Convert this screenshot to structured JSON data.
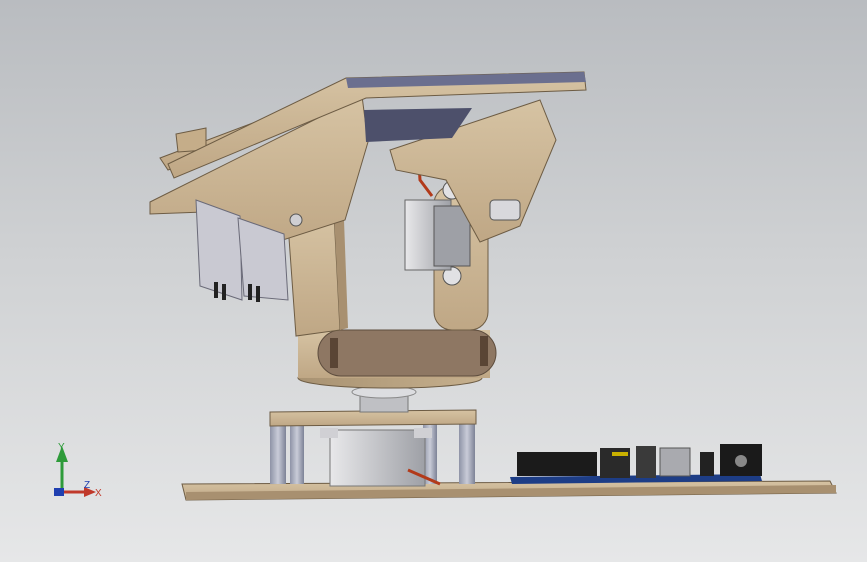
{
  "viewport": {
    "background_top": "#b9bcc0",
    "background_bottom": "#e6e7e8",
    "wood_color": "#cbb594",
    "wood_dark": "#a38d6d",
    "panel_color": "#6b6f8f"
  },
  "triad": {
    "y_label": "Y",
    "x_label": "X",
    "z_label": "Z",
    "y_color": "#2e9b3a",
    "x_color": "#c0392b",
    "z_color": "#1f3fb0"
  }
}
